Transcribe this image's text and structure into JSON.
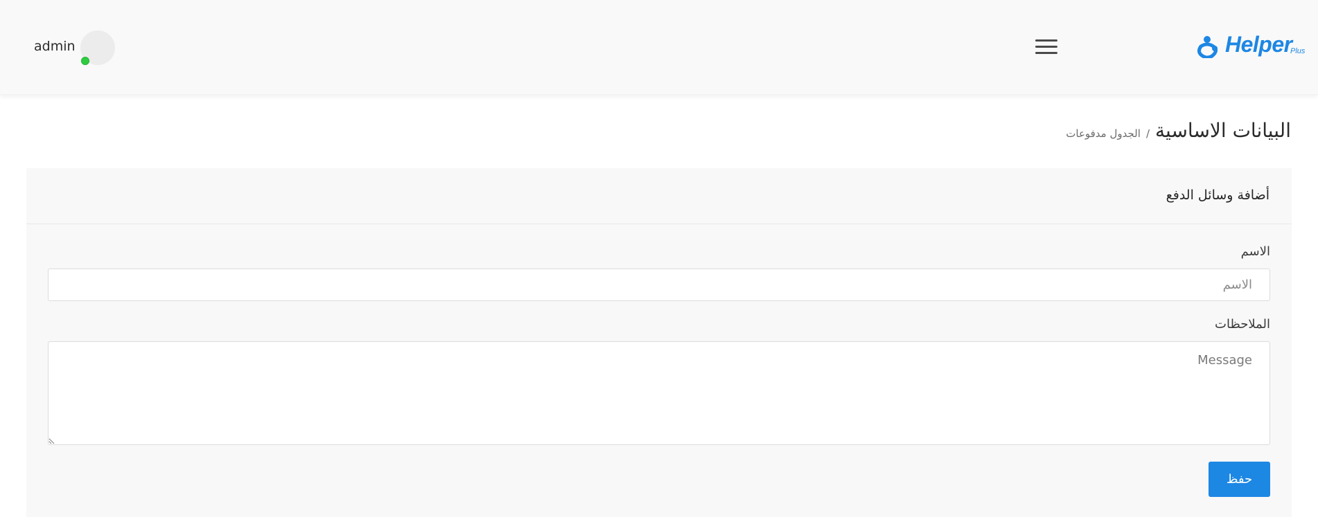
{
  "header": {
    "username": "admin",
    "status_color": "#2ecc40",
    "menu_icon": "hamburger-menu-icon",
    "logo": {
      "text": "Helper",
      "sub": "Plus",
      "color": "#1d87e4"
    }
  },
  "page": {
    "title": "البيانات الاساسية",
    "breadcrumb_separator": "/",
    "breadcrumb_current": "الجدول مدفوعات"
  },
  "form": {
    "card_title": "أضافة وسائل الدفع",
    "name_label": "الاسم",
    "name_placeholder": "الاسم",
    "name_value": "",
    "notes_label": "الملاحظات",
    "notes_placeholder": "Message",
    "notes_value": "",
    "save_label": "حفظ"
  },
  "colors": {
    "accent": "#1d87e4",
    "topbar_bg": "#f9f9f9",
    "card_bg": "#f8f8f8"
  }
}
